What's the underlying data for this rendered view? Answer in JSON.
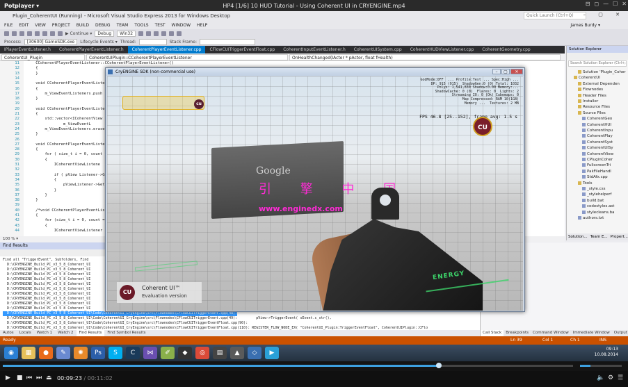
{
  "player": {
    "logo": "Potplayer ▾",
    "title": "HP4  [1/6] 10 HUD Tutorial - Using Coherent UI in CRYENGINE.mp4",
    "window_controls": [
      "⊟",
      "◻",
      "—",
      "☐",
      "✕"
    ],
    "current_time": "00:09:23",
    "duration": "/ 00:11:02",
    "progress": 0.765,
    "volume": 0.25
  },
  "vs": {
    "title": "Plugin_CoherentUI (Running) - Microsoft Visual Studio Express 2013 for Windows Desktop",
    "quick_launch_placeholder": "Quick Launch (Ctrl+Q)",
    "menu": [
      "FILE",
      "EDIT",
      "VIEW",
      "PROJECT",
      "BUILD",
      "DEBUG",
      "TEAM",
      "TOOLS",
      "TEST",
      "WINDOW",
      "HELP"
    ],
    "user": "James Burdy ▾",
    "toolbar": {
      "continue": "▶ Continue ▾",
      "config": "Debug",
      "platform": "Win32",
      "process_label": "Process:",
      "process": "[30600] GameSDK.exe",
      "lifecycle": "Lifecycle Events ▾",
      "thread": "Thread:",
      "stackframe": "Stack Frame:"
    },
    "tabs": [
      "IPlayerEventListener.h",
      "CoherentPlayerEventListener.h",
      "CoherentPlayerEventListener.cpp",
      "CFlowCUITriggerEventFloat.cpp",
      "CoherentInputEventListener.h",
      "CoherentUISystem.cpp",
      "CoherentHUDViewListener.cpp",
      "CoherentGeometry.cpp"
    ],
    "active_tab": 2,
    "scope_project": "CoherentUI_Plugin",
    "scope_class": "CoherentUIPlugin::CCoherentPlayerEventListener",
    "scope_method": "OnHealthChanged(IActor * pActor, float fHealth)",
    "code_lines": [
      {
        "n": "11",
        "t": "    CCoherentPlayerEventListener::CCoherentPlayerEventListener()"
      },
      {
        "n": "12",
        "t": "    {"
      },
      {
        "n": "13",
        "t": "    }"
      },
      {
        "n": "14",
        "t": ""
      },
      {
        "n": "15",
        "t": "    void CCoherentPlayerEventListener"
      },
      {
        "n": "16",
        "t": "    {"
      },
      {
        "n": "17",
        "t": "        m_ViewEventListeners.push"
      },
      {
        "n": "18",
        "t": "    }"
      },
      {
        "n": "19",
        "t": ""
      },
      {
        "n": "20",
        "t": "    void CCoherentPlayerEventListen"
      },
      {
        "n": "21",
        "t": "    {"
      },
      {
        "n": "22",
        "t": "        std::vector<ICoherentView"
      },
      {
        "n": "23",
        "t": "                m_ViewEventL"
      },
      {
        "n": "24",
        "t": "        m_ViewEventListeners.erase"
      },
      {
        "n": "25",
        "t": "    }"
      },
      {
        "n": "26",
        "t": ""
      },
      {
        "n": "27",
        "t": "    void CCoherentPlayerEventListen"
      },
      {
        "n": "28",
        "t": "    {"
      },
      {
        "n": "29",
        "t": "        for ( size_t i = 0, count"
      },
      {
        "n": "30",
        "t": "        {"
      },
      {
        "n": "31",
        "t": "            ICoherentViewListene"
      },
      {
        "n": "32",
        "t": ""
      },
      {
        "n": "33",
        "t": "            if ( pView Listener->GetV"
      },
      {
        "n": "34",
        "t": "            {"
      },
      {
        "n": "35",
        "t": "                pViewListener->GetV"
      },
      {
        "n": "36",
        "t": "            }"
      },
      {
        "n": "37",
        "t": "        }"
      },
      {
        "n": "38",
        "t": "    }"
      },
      {
        "n": "39",
        "t": ""
      },
      {
        "n": "40",
        "t": "    /*void CCoherentPlayerEventList"
      },
      {
        "n": "41",
        "t": "    {"
      },
      {
        "n": "42",
        "t": "        for (size_t i = 0, count ="
      },
      {
        "n": "43",
        "t": "        {"
      },
      {
        "n": "44",
        "t": "            ICoherentViewListener"
      }
    ],
    "zoom": "100 %  ▾",
    "find_title": "Find Results",
    "find_lines": [
      "Find all \"TriggerEvent\", Subfolders, Find",
      "  D:\\CRYENGINE_Build_PC_v3_5_8_Coherent_UI",
      "  D:\\CRYENGINE_Build_PC_v3_5_8_Coherent_UI",
      "  D:\\CRYENGINE_Build_PC_v3_5_8_Coherent_UI",
      "  D:\\CRYENGINE_Build_PC_v3_5_8_Coherent_UI",
      "  D:\\CRYENGINE_Build_PC_v3_5_8_Coherent_UI",
      "  D:\\CRYENGINE_Build_PC_v3_5_8_Coherent_UI",
      "  D:\\CRYENGINE_Build_PC_v3_5_8_Coherent_UI",
      "  D:\\CRYENGINE_Build_PC_v3_5_8_Coherent_UI",
      "  D:\\CRYENGINE_Build_PC_v3_5_8_Coherent_UI",
      "  D:\\CRYENGINE_Build_PC_v3_5_8_Coherent_UI",
      "  D:\\CRYENGINE_Build_PC_v3_5_8_Coherent_UI\\Code\\CoherentUI_CryEngine\\src\\Flownodes\\CFlowCUITriggerEvent.cpp(48):",
      "  D:\\CRYENGINE_Build_PC_v3_5_8_Coherent_UI\\Code\\CoherentUI_CryEngine\\src\\Flownodes\\CFlowCUITriggerEvent.cpp(49):         pView->TriggerEvent( sEvent.c_str(),",
      "  D:\\CRYENGINE_Build_PC_v3_5_8_Coherent_UI\\Code\\CoherentUI_CryEngine\\src\\Flownodes\\CFlowCUITriggerEventFloat.cpp(90):",
      "  D:\\CRYENGINE_Build_PC_v3_5_8_Coherent_UI\\Code\\CoherentUI_CryEngine\\src\\Flownodes\\CFlowCUITriggerEventFloat.cpp(110): REGISTER_FLOW_NODE_EX( \"CoherentUI_Plugin:TriggerEventFloat\", CoherentUIPlugin::CFlo"
    ],
    "selected_find_line": 11,
    "bottom_tabs": [
      "Autos",
      "Locals",
      "Watch 1",
      "Watch 2",
      "Find Results",
      "Find Symbol Results"
    ],
    "active_bottom_tab": 4,
    "right_bottom_tabs": [
      "Call Stack",
      "Breakpoints",
      "Command Window",
      "Immediate Window",
      "Output"
    ],
    "status": {
      "ready": "Ready",
      "ln": "Ln 39",
      "col": "Col 1",
      "ch": "Ch 1",
      "ins": "INS"
    }
  },
  "solution": {
    "title": "Solution Explorer",
    "search_placeholder": "Search Solution Explorer (Ctrl+;)",
    "items": [
      {
        "label": "Solution 'Plugin_Coher",
        "kind": "folder"
      },
      {
        "label": "CoherentUI",
        "kind": "folder"
      },
      {
        "label": "External Dependen",
        "kind": "folder"
      },
      {
        "label": "Flownodes",
        "kind": "folder"
      },
      {
        "label": "Header Files",
        "kind": "folder"
      },
      {
        "label": "Installer",
        "kind": "folder"
      },
      {
        "label": "Resource Files",
        "kind": "folder"
      },
      {
        "label": "Source Files",
        "kind": "folder"
      },
      {
        "label": "CoherentGeo",
        "kind": "file"
      },
      {
        "label": "CoherentHUI",
        "kind": "file"
      },
      {
        "label": "CoherentInpu",
        "kind": "file"
      },
      {
        "label": "CoherentPlay",
        "kind": "file"
      },
      {
        "label": "CoherentSyst",
        "kind": "file"
      },
      {
        "label": "CoherentUISy",
        "kind": "file"
      },
      {
        "label": "CoherentView",
        "kind": "file"
      },
      {
        "label": "CPluginCoher",
        "kind": "file"
      },
      {
        "label": "FullscreenTri",
        "kind": "file"
      },
      {
        "label": "PakFileHandl",
        "kind": "file"
      },
      {
        "label": "StdAfx.cpp",
        "kind": "file"
      },
      {
        "label": "Tools",
        "kind": "folder"
      },
      {
        "label": "_style.css",
        "kind": "file"
      },
      {
        "label": "_stylehelperf",
        "kind": "file"
      },
      {
        "label": "build.bat",
        "kind": "file"
      },
      {
        "label": "codestyles.ast",
        "kind": "file"
      },
      {
        "label": "stylecleans.ba",
        "kind": "file"
      },
      {
        "label": "authors.txt",
        "kind": "file"
      }
    ],
    "bottom_tabs": [
      "Solution...",
      "Team E...",
      "Propert..."
    ]
  },
  "cryengine": {
    "title": "CryENGINE SDK (non-commercial use)",
    "debug_text": "GodMode:OFF  ... Profile:Test ... Spec:High ...\nDP: 915 (915)  ShadowGen:0 (0) Total: 1032\nPolys: 1,541,830 Shadow:0.00 Memory:...\nShadowCache: 0 (0)  Flares: 0  Lights: 2\nStreaming IO: 0 (Ok) Cubemaps: 0\nMap Compressed: RAM 10(1GB)\nMemory ...  Textures: 2 MB",
    "fps": "FPS 46.8 [25..152], frame avg: 1.5 s",
    "banner_logo": "Google",
    "overlay_cn": "引 擎 中 国",
    "overlay_url": "www.enginedx.com",
    "energy_label": "ENERGY",
    "cu_logo": "CU",
    "cu_badge_title": "Coherent UI™",
    "cu_badge_sub": "Evaluation version"
  },
  "taskbar": {
    "apps": [
      "start-orb",
      "explorer",
      "firefox",
      "vs-editor",
      "blender",
      "photoshop",
      "skype",
      "coherent",
      "vs",
      "notepad",
      "unity",
      "chrome",
      "film",
      "cry",
      "sdk",
      "potplayer"
    ],
    "time": "09:13",
    "date": "10.08.2014"
  }
}
